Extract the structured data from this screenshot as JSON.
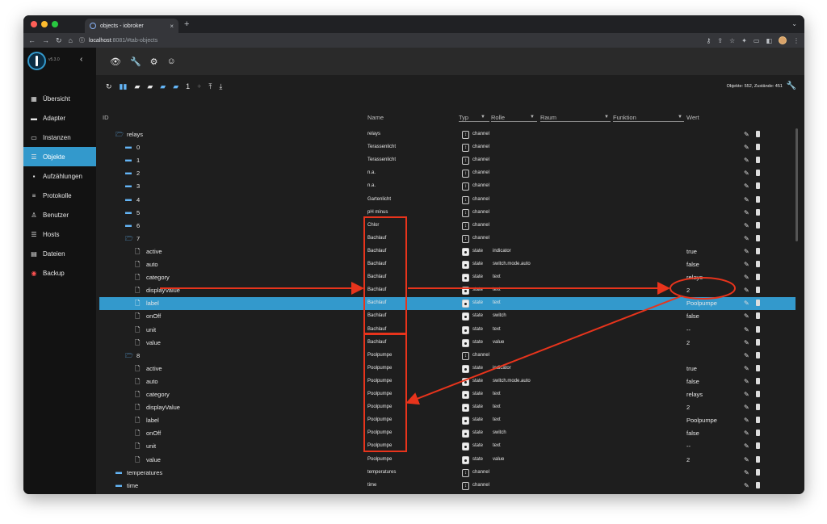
{
  "browser": {
    "tab_title": "objects - iobroker",
    "tab_close": "×",
    "new_tab": "+",
    "url_host": "localhost",
    "url_path": ":8081/#tab-objects",
    "tab_menu": "⌄",
    "nav_back": "←",
    "nav_forward": "→",
    "nav_reload": "↻",
    "nav_home": "⌂",
    "info": "ⓘ",
    "traffic_colors": [
      "#ff5f57",
      "#febc2e",
      "#28c840"
    ]
  },
  "sidebar": {
    "version": "v5.3.0",
    "collapse": "‹",
    "items": [
      {
        "label": "Übersicht",
        "icon": "▦",
        "icon_name": "grid-icon"
      },
      {
        "label": "Adapter",
        "icon": "▬",
        "icon_name": "adapter-icon"
      },
      {
        "label": "Instanzen",
        "icon": "▭",
        "icon_name": "instances-icon"
      },
      {
        "label": "Objekte",
        "icon": "☰",
        "icon_name": "list-icon"
      },
      {
        "label": "Aufzählungen",
        "icon": "▪",
        "icon_name": "enum-icon"
      },
      {
        "label": "Protokolle",
        "icon": "≡",
        "icon_name": "log-icon"
      },
      {
        "label": "Benutzer",
        "icon": "♙",
        "icon_name": "user-icon"
      },
      {
        "label": "Hosts",
        "icon": "☰",
        "icon_name": "hosts-icon"
      },
      {
        "label": "Dateien",
        "icon": "▤",
        "icon_name": "files-icon"
      },
      {
        "label": "Backup",
        "icon": "◉",
        "icon_name": "backup-icon"
      }
    ]
  },
  "topbar": {
    "icons": [
      "👁",
      "🔧",
      "⚙",
      "☺"
    ]
  },
  "toolbar": {
    "refresh": "↻",
    "counts": "Objekte: 552, Zustände: 451",
    "settings": "🔧",
    "icons": [
      "▮▮",
      "▰",
      "▰",
      "▰",
      "▰",
      "1",
      "+",
      "⤒",
      "⤓"
    ]
  },
  "columns": {
    "id": "ID",
    "name": "Name",
    "type": "Typ",
    "role": "Rolle",
    "room": "Raum",
    "function": "Funktion",
    "value": "Wert",
    "dropdown": "▼"
  },
  "rows": [
    {
      "id": "relays",
      "name": "relays",
      "type": "channel",
      "role": "",
      "value": "",
      "kind": "folder-open",
      "level": 1
    },
    {
      "id": "0",
      "name": "Terassenlicht",
      "type": "channel",
      "role": "",
      "value": "",
      "kind": "folder",
      "level": 2
    },
    {
      "id": "1",
      "name": "Terassenlicht",
      "type": "channel",
      "role": "",
      "value": "",
      "kind": "folder",
      "level": 2
    },
    {
      "id": "2",
      "name": "n.a.",
      "type": "channel",
      "role": "",
      "value": "",
      "kind": "folder",
      "level": 2
    },
    {
      "id": "3",
      "name": "n.a.",
      "type": "channel",
      "role": "",
      "value": "",
      "kind": "folder",
      "level": 2
    },
    {
      "id": "4",
      "name": "Gartenlicht",
      "type": "channel",
      "role": "",
      "value": "",
      "kind": "folder",
      "level": 2
    },
    {
      "id": "5",
      "name": "pH minus",
      "type": "channel",
      "role": "",
      "value": "",
      "kind": "folder",
      "level": 2
    },
    {
      "id": "6",
      "name": "Chlor",
      "type": "channel",
      "role": "",
      "value": "",
      "kind": "folder",
      "level": 2
    },
    {
      "id": "7",
      "name": "Bachlauf",
      "type": "channel",
      "role": "",
      "value": "",
      "kind": "folder-open",
      "level": 2
    },
    {
      "id": "active",
      "name": "Bachlauf",
      "type": "state",
      "role": "indicator",
      "value": "true",
      "kind": "file",
      "level": 3
    },
    {
      "id": "auto",
      "name": "Bachlauf",
      "type": "state",
      "role": "switch.mode.auto",
      "value": "false",
      "kind": "file",
      "level": 3
    },
    {
      "id": "category",
      "name": "Bachlauf",
      "type": "state",
      "role": "text",
      "value": "relays",
      "kind": "file",
      "level": 3
    },
    {
      "id": "displayValue",
      "name": "Bachlauf",
      "type": "state",
      "role": "text",
      "value": "2",
      "kind": "file",
      "level": 3
    },
    {
      "id": "label",
      "name": "Bachlauf",
      "type": "state",
      "role": "text",
      "value": "Poolpumpe",
      "kind": "file",
      "level": 3,
      "selected": true
    },
    {
      "id": "onOff",
      "name": "Bachlauf",
      "type": "state",
      "role": "switch",
      "value": "false",
      "kind": "file",
      "level": 3
    },
    {
      "id": "unit",
      "name": "Bachlauf",
      "type": "state",
      "role": "text",
      "value": "--",
      "kind": "file",
      "level": 3
    },
    {
      "id": "value",
      "name": "Bachlauf",
      "type": "state",
      "role": "value",
      "value": "2",
      "kind": "file",
      "level": 3
    },
    {
      "id": "8",
      "name": "Poolpumpe",
      "type": "channel",
      "role": "",
      "value": "",
      "kind": "folder-open",
      "level": 2
    },
    {
      "id": "active",
      "name": "Poolpumpe",
      "type": "state",
      "role": "indicator",
      "value": "true",
      "kind": "file",
      "level": 3
    },
    {
      "id": "auto",
      "name": "Poolpumpe",
      "type": "state",
      "role": "switch.mode.auto",
      "value": "false",
      "kind": "file",
      "level": 3
    },
    {
      "id": "category",
      "name": "Poolpumpe",
      "type": "state",
      "role": "text",
      "value": "relays",
      "kind": "file",
      "level": 3
    },
    {
      "id": "displayValue",
      "name": "Poolpumpe",
      "type": "state",
      "role": "text",
      "value": "2",
      "kind": "file",
      "level": 3
    },
    {
      "id": "label",
      "name": "Poolpumpe",
      "type": "state",
      "role": "text",
      "value": "Poolpumpe",
      "kind": "file",
      "level": 3
    },
    {
      "id": "onOff",
      "name": "Poolpumpe",
      "type": "state",
      "role": "switch",
      "value": "false",
      "kind": "file",
      "level": 3
    },
    {
      "id": "unit",
      "name": "Poolpumpe",
      "type": "state",
      "role": "text",
      "value": "--",
      "kind": "file",
      "level": 3
    },
    {
      "id": "value",
      "name": "Poolpumpe",
      "type": "state",
      "role": "value",
      "value": "2",
      "kind": "file",
      "level": 3
    },
    {
      "id": "temperatures",
      "name": "temperatures",
      "type": "channel",
      "role": "",
      "value": "",
      "kind": "folder",
      "level": 1
    },
    {
      "id": "time",
      "name": "time",
      "type": "channel",
      "role": "",
      "value": "",
      "kind": "folder",
      "level": 1
    },
    {
      "id": "admin",
      "name": "admin",
      "type": "meta",
      "role": "",
      "value": "",
      "kind": "folder",
      "level": 0
    }
  ],
  "colors": {
    "accent": "#3399cc",
    "annotation": "#e8341c",
    "folder": "#64b5f6"
  }
}
